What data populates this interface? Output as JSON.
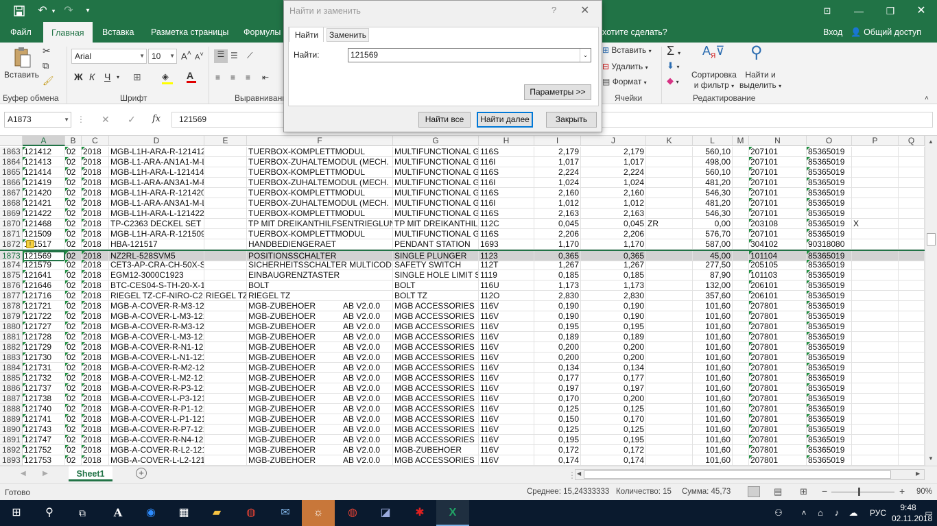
{
  "title": {
    "icons": [
      "save-icon",
      "undo-icon",
      "redo-icon",
      "customize-icon"
    ],
    "window_buttons": [
      "▢",
      "—",
      "❐",
      "✕"
    ]
  },
  "tabs": [
    "Файл",
    "Главная",
    "Вставка",
    "Разметка страницы",
    "Формулы"
  ],
  "tellme": "хотите сделать?",
  "signin": "Вход",
  "share": "Общий доступ",
  "ribbon": {
    "paste": "Вставить",
    "clipboard": "Буфер обмена",
    "font_name": "Arial",
    "font_size": "10",
    "bold": "Ж",
    "italic": "К",
    "underline": "Ч",
    "font": "Шрифт",
    "alignment": "Выравнивани",
    "insert": "Вставить",
    "delete": "Удалить",
    "format": "Формат",
    "cells": "Ячейки",
    "sort": "Сортировка\nи фильтр",
    "sort1": "Сортировка",
    "sort2": "и фильтр",
    "find1": "Найти и",
    "find2": "выделить",
    "editing": "Редактирование"
  },
  "formula_bar": {
    "name_box": "A1873",
    "fx": "fx",
    "value": "121569"
  },
  "columns": [
    "A",
    "B",
    "C",
    "D",
    "E",
    "F",
    "G",
    "H",
    "I",
    "J",
    "K",
    "L",
    "M",
    "N",
    "O",
    "P",
    "Q"
  ],
  "rows": [
    {
      "n": "1863",
      "a": "121412",
      "b": "02",
      "c": "2018",
      "d": "MGB-L1H-ARA-R-121412",
      "e": "",
      "f": "TUERBOX-KOMPLETTMODUL",
      "f2": "",
      "g": "MULTIFUNCTIONAL G",
      "h": "116S",
      "i": "2,179",
      "j": "2,179",
      "k": "",
      "l": "560,10",
      "n2": "207101",
      "o": "85365019",
      "p": ""
    },
    {
      "n": "1864",
      "a": "121413",
      "b": "02",
      "c": "2018",
      "d": "MGB-L1-ARA-AN1A1-M-L",
      "e": "",
      "f": "TUERBOX-ZUHALTEMODUL  (MECH.",
      "f2": "",
      "g": "MULTIFUNCTIONAL G",
      "h": "116I",
      "i": "1,017",
      "j": "1,017",
      "k": "",
      "l": "498,00",
      "n2": "207101",
      "o": "85365019",
      "p": ""
    },
    {
      "n": "1865",
      "a": "121414",
      "b": "02",
      "c": "2018",
      "d": "MGB-L1H-ARA-L-121414",
      "e": "",
      "f": "TUERBOX-KOMPLETTMODUL",
      "f2": "",
      "g": "MULTIFUNCTIONAL G",
      "h": "116S",
      "i": "2,224",
      "j": "2,224",
      "k": "",
      "l": "560,10",
      "n2": "207101",
      "o": "85365019",
      "p": ""
    },
    {
      "n": "1866",
      "a": "121419",
      "b": "02",
      "c": "2018",
      "d": "MGB-L1-ARA-AN3A1-M-R",
      "e": "",
      "f": "TUERBOX-ZUHALTEMODUL  (MECH.",
      "f2": "",
      "g": "MULTIFUNCTIONAL G",
      "h": "116I",
      "i": "1,024",
      "j": "1,024",
      "k": "",
      "l": "481,20",
      "n2": "207101",
      "o": "85365019",
      "p": ""
    },
    {
      "n": "1867",
      "a": "121420",
      "b": "02",
      "c": "2018",
      "d": "MGB-L1H-ARA-R-121420",
      "e": "",
      "f": "TUERBOX-KOMPLETTMODUL",
      "f2": "",
      "g": "MULTIFUNCTIONAL G",
      "h": "116S",
      "i": "2,160",
      "j": "2,160",
      "k": "",
      "l": "546,30",
      "n2": "207101",
      "o": "85365019",
      "p": ""
    },
    {
      "n": "1868",
      "a": "121421",
      "b": "02",
      "c": "2018",
      "d": "MGB-L1-ARA-AN3A1-M-L",
      "e": "",
      "f": "TUERBOX-ZUHALTEMODUL  (MECH.",
      "f2": "",
      "g": "MULTIFUNCTIONAL G",
      "h": "116I",
      "i": "1,012",
      "j": "1,012",
      "k": "",
      "l": "481,20",
      "n2": "207101",
      "o": "85365019",
      "p": ""
    },
    {
      "n": "1869",
      "a": "121422",
      "b": "02",
      "c": "2018",
      "d": "MGB-L1H-ARA-L-121422",
      "e": "",
      "f": "TUERBOX-KOMPLETTMODUL",
      "f2": "",
      "g": "MULTIFUNCTIONAL G",
      "h": "116S",
      "i": "2,163",
      "j": "2,163",
      "k": "",
      "l": "546,30",
      "n2": "207101",
      "o": "85365019",
      "p": ""
    },
    {
      "n": "1870",
      "a": "121468",
      "b": "02",
      "c": "2018",
      "d": "TP-C2363 DECKEL SET",
      "e": "",
      "f": "TP MIT DREIKANTHILFSENTRIEGLUN",
      "f2": "",
      "g": "TP MIT DREIKANTHILF",
      "h": "112C",
      "i": "0,045",
      "j": "0,045",
      "k": "ZR",
      "l": "0,00",
      "n2": "203108",
      "o": "85365019",
      "p": "X"
    },
    {
      "n": "1871",
      "a": "121509",
      "b": "02",
      "c": "2018",
      "d": "MGB-L1H-ARA-R-121509",
      "e": "",
      "f": "TUERBOX-KOMPLETTMODUL",
      "f2": "",
      "g": "MULTIFUNCTIONAL G",
      "h": "116S",
      "i": "2,206",
      "j": "2,206",
      "k": "",
      "l": "576,70",
      "n2": "207101",
      "o": "85365019",
      "p": ""
    },
    {
      "n": "1872",
      "a": "121517",
      "b": "02",
      "c": "2018",
      "d": "HBA-121517",
      "e": "",
      "f": "HANDBEDIENGERAET",
      "f2": "",
      "g": "PENDANT STATION",
      "h": "1693",
      "i": "1,170",
      "j": "1,170",
      "k": "",
      "l": "587,00",
      "n2": "304102",
      "o": "90318080",
      "p": ""
    },
    {
      "n": "1873",
      "a": "121569",
      "b": "02",
      "c": "2018",
      "d": "NZ2RL-528SVM5",
      "e": "",
      "f": "POSITIONSSCHALTER",
      "f2": "",
      "g": "SINGLE PLUNGER",
      "h": "1123",
      "i": "0,365",
      "j": "0,365",
      "k": "",
      "l": "45,00",
      "n2": "101104",
      "o": "85365019",
      "p": ""
    },
    {
      "n": "1874",
      "a": "121579",
      "b": "02",
      "c": "2018",
      "d": "CET3-AP-CRA-CH-50X-S",
      "e": "",
      "f": "SICHERHEITSSCHALTER MULTICOD",
      "f2": "",
      "g": "SAFETY SWITCH",
      "h": "112T",
      "i": "1,267",
      "j": "1,267",
      "k": "",
      "l": "277,50",
      "n2": "205105",
      "o": "85365019",
      "p": ""
    },
    {
      "n": "1875",
      "a": "121641",
      "b": "02",
      "c": "2018",
      "d": "EGM12-3000C1923",
      "e": "",
      "f": "EINBAUGRENZTASTER",
      "f2": "",
      "g": "SINGLE HOLE LIMIT S",
      "h": "1119",
      "i": "0,185",
      "j": "0,185",
      "k": "",
      "l": "87,90",
      "n2": "101103",
      "o": "85365019",
      "p": ""
    },
    {
      "n": "1876",
      "a": "121646",
      "b": "02",
      "c": "2018",
      "d": "BTC-CES04-S-TH-20-X-1",
      "e": "",
      "f": "BOLT",
      "f2": "",
      "g": "BOLT",
      "h": "116U",
      "i": "1,173",
      "j": "1,173",
      "k": "",
      "l": "132,00",
      "n2": "206101",
      "o": "85365019",
      "p": ""
    },
    {
      "n": "1877",
      "a": "121716",
      "b": "02",
      "c": "2018",
      "d": "RIEGEL TZ-CF-NIRO-C2",
      "e": "RIEGEL TZ",
      "f": "RIEGEL TZ",
      "f2": "",
      "g": "BOLT TZ",
      "h": "112O",
      "i": "2,830",
      "j": "2,830",
      "k": "",
      "l": "357,60",
      "n2": "206101",
      "o": "85365019",
      "p": ""
    },
    {
      "n": "1878",
      "a": "121721",
      "b": "02",
      "c": "2018",
      "d": "MGB-A-COVER-R-M3-121",
      "e": "",
      "f": "MGB-ZUBEHOER",
      "f2": "AB V2.0.0",
      "g": "MGB ACCESSORIES",
      "h": "116V",
      "i": "0,190",
      "j": "0,190",
      "k": "",
      "l": "101,60",
      "n2": "207801",
      "o": "85365019",
      "p": ""
    },
    {
      "n": "1879",
      "a": "121722",
      "b": "02",
      "c": "2018",
      "d": "MGB-A-COVER-L-M3-121",
      "e": "",
      "f": "MGB-ZUBEHOER",
      "f2": "AB V2.0.0",
      "g": "MGB ACCESSORIES",
      "h": "116V",
      "i": "0,190",
      "j": "0,190",
      "k": "",
      "l": "101,60",
      "n2": "207801",
      "o": "85365019",
      "p": ""
    },
    {
      "n": "1880",
      "a": "121727",
      "b": "02",
      "c": "2018",
      "d": "MGB-A-COVER-R-M3-121",
      "e": "",
      "f": "MGB-ZUBEHOER",
      "f2": "AB V2.0.0",
      "g": "MGB ACCESSORIES",
      "h": "116V",
      "i": "0,195",
      "j": "0,195",
      "k": "",
      "l": "101,60",
      "n2": "207801",
      "o": "85365019",
      "p": ""
    },
    {
      "n": "1881",
      "a": "121728",
      "b": "02",
      "c": "2018",
      "d": "MGB-A-COVER-L-M3-121",
      "e": "",
      "f": "MGB-ZUBEHOER",
      "f2": "AB V2.0.0",
      "g": "MGB ACCESSORIES",
      "h": "116V",
      "i": "0,189",
      "j": "0,189",
      "k": "",
      "l": "101,60",
      "n2": "207801",
      "o": "85365019",
      "p": ""
    },
    {
      "n": "1882",
      "a": "121729",
      "b": "02",
      "c": "2018",
      "d": "MGB-A-COVER-R-N1-121",
      "e": "",
      "f": "MGB-ZUBEHOER",
      "f2": "AB V2.0.0",
      "g": "MGB ACCESSORIES",
      "h": "116V",
      "i": "0,200",
      "j": "0,200",
      "k": "",
      "l": "101,60",
      "n2": "207801",
      "o": "85365019",
      "p": ""
    },
    {
      "n": "1883",
      "a": "121730",
      "b": "02",
      "c": "2018",
      "d": "MGB-A-COVER-L-N1-121",
      "e": "",
      "f": "MGB-ZUBEHOER",
      "f2": "AB V2.0.0",
      "g": "MGB ACCESSORIES",
      "h": "116V",
      "i": "0,200",
      "j": "0,200",
      "k": "",
      "l": "101,60",
      "n2": "207801",
      "o": "85365019",
      "p": ""
    },
    {
      "n": "1884",
      "a": "121731",
      "b": "02",
      "c": "2018",
      "d": "MGB-A-COVER-R-M2-121",
      "e": "",
      "f": "MGB-ZUBEHOER",
      "f2": "AB V2.0.0",
      "g": "MGB ACCESSORIES",
      "h": "116V",
      "i": "0,134",
      "j": "0,134",
      "k": "",
      "l": "101,60",
      "n2": "207801",
      "o": "85365019",
      "p": ""
    },
    {
      "n": "1885",
      "a": "121732",
      "b": "02",
      "c": "2018",
      "d": "MGB-A-COVER-L-M2-121",
      "e": "",
      "f": "MGB-ZUBEHOER",
      "f2": "AB V2.0.0",
      "g": "MGB ACCESSORIES",
      "h": "116V",
      "i": "0,177",
      "j": "0,177",
      "k": "",
      "l": "101,60",
      "n2": "207801",
      "o": "85365019",
      "p": ""
    },
    {
      "n": "1886",
      "a": "121737",
      "b": "02",
      "c": "2018",
      "d": "MGB-A-COVER-R-P3-121",
      "e": "",
      "f": "MGB-ZUBEHOER",
      "f2": "AB V2.0.0",
      "g": "MGB ACCESSORIES",
      "h": "116V",
      "i": "0,197",
      "j": "0,197",
      "k": "",
      "l": "101,60",
      "n2": "207801",
      "o": "85365019",
      "p": ""
    },
    {
      "n": "1887",
      "a": "121738",
      "b": "02",
      "c": "2018",
      "d": "MGB-A-COVER-L-P3-121",
      "e": "",
      "f": "MGB-ZUBEHOER",
      "f2": "AB V2.0.0",
      "g": "MGB ACCESSORIES",
      "h": "116V",
      "i": "0,170",
      "j": "0,200",
      "k": "",
      "l": "101,60",
      "n2": "207801",
      "o": "85365019",
      "p": ""
    },
    {
      "n": "1888",
      "a": "121740",
      "b": "02",
      "c": "2018",
      "d": "MGB-A-COVER-R-P1-121",
      "e": "",
      "f": "MGB-ZUBEHOER",
      "f2": "AB V2.0.0",
      "g": "MGB ACCESSORIES",
      "h": "116V",
      "i": "0,125",
      "j": "0,125",
      "k": "",
      "l": "101,60",
      "n2": "207801",
      "o": "85365019",
      "p": ""
    },
    {
      "n": "1889",
      "a": "121741",
      "b": "02",
      "c": "2018",
      "d": "MGB-A-COVER-L-P1-121",
      "e": "",
      "f": "MGB-ZUBEHOER",
      "f2": "AB V2.0.0",
      "g": "MGB ACCESSORIES",
      "h": "116V",
      "i": "0,150",
      "j": "0,170",
      "k": "",
      "l": "101,60",
      "n2": "207801",
      "o": "85365019",
      "p": ""
    },
    {
      "n": "1890",
      "a": "121743",
      "b": "02",
      "c": "2018",
      "d": "MGB-A-COVER-R-P7-121",
      "e": "",
      "f": "MGB-ZUBEHOER",
      "f2": "AB V2.0.0",
      "g": "MGB ACCESSORIES",
      "h": "116V",
      "i": "0,125",
      "j": "0,125",
      "k": "",
      "l": "101,60",
      "n2": "207801",
      "o": "85365019",
      "p": ""
    },
    {
      "n": "1891",
      "a": "121747",
      "b": "02",
      "c": "2018",
      "d": "MGB-A-COVER-R-N4-121",
      "e": "",
      "f": "MGB-ZUBEHOER",
      "f2": "AB V2.0.0",
      "g": "MGB ACCESSORIES",
      "h": "116V",
      "i": "0,195",
      "j": "0,195",
      "k": "",
      "l": "101,60",
      "n2": "207801",
      "o": "85365019",
      "p": ""
    },
    {
      "n": "1892",
      "a": "121752",
      "b": "02",
      "c": "2018",
      "d": "MGB-A-COVER-R-L2-121",
      "e": "",
      "f": "MGB-ZUBEHOER",
      "f2": "AB V2.0.0",
      "g": "MGB-ZUBEHOER",
      "h": "116V",
      "i": "0,172",
      "j": "0,172",
      "k": "",
      "l": "101,60",
      "n2": "207801",
      "o": "85365019",
      "p": ""
    },
    {
      "n": "1893",
      "a": "121753",
      "b": "02",
      "c": "2018",
      "d": "MGB-A-COVER-L-L2-121",
      "e": "",
      "f": "MGB-ZUBEHOER",
      "f2": "AB V2.0.0",
      "g": "MGB ACCESSORIES",
      "h": "116V",
      "i": "0,174",
      "j": "0,174",
      "k": "",
      "l": "101,60",
      "n2": "207801",
      "o": "85365019",
      "p": ""
    }
  ],
  "sheet_tab": "Sheet1",
  "status": {
    "ready": "Готово",
    "average": "Среднее: 15,24333333",
    "count": "Количество: 15",
    "sum": "Сумма: 45,73",
    "zoom": "90%"
  },
  "dialog": {
    "title": "Найти и заменить",
    "help": "?",
    "tab_find": "Найти",
    "tab_replace": "Заменить",
    "find_label": "Найти:",
    "find_value": "121569",
    "options": "Параметры >>",
    "find_all": "Найти все",
    "find_next": "Найти далее",
    "close": "Закрыть"
  },
  "taskbar": {
    "lang": "РУС",
    "time": "9:48",
    "date": "02.11.2018"
  }
}
